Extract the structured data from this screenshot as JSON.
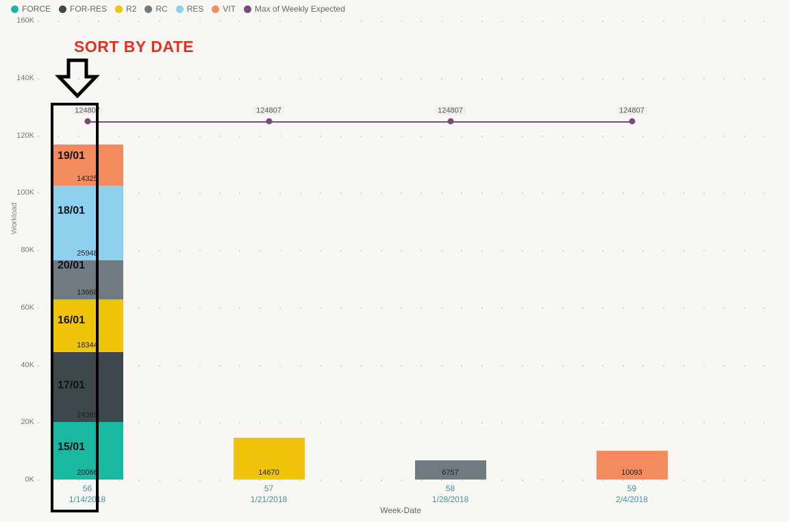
{
  "legend": [
    {
      "name": "FORCE",
      "color": "#19b8a1"
    },
    {
      "name": "FOR-RES",
      "color": "#3d474c"
    },
    {
      "name": "R2",
      "color": "#f0c40b"
    },
    {
      "name": "RC",
      "color": "#6f7b80"
    },
    {
      "name": "RES",
      "color": "#8ed1ef"
    },
    {
      "name": "VIT",
      "color": "#f48b5f"
    },
    {
      "name": "Max of Weekly Expected",
      "color": "#7a4b78"
    }
  ],
  "y_ticks": [
    "0K",
    "20K",
    "40K",
    "60K",
    "80K",
    "100K",
    "120K",
    "140K",
    "160K"
  ],
  "y_label": "Workload",
  "x_title": "Week-Date",
  "annotation_title": "SORT BY DATE",
  "dates_overlay": [
    "19/01",
    "18/01",
    "20/01",
    "16/01",
    "17/01",
    "15/01"
  ],
  "chart_data": {
    "type": "bar",
    "y_axis": {
      "label": "Workload",
      "min": 0,
      "max": 160000
    },
    "x_axis": {
      "label": "Week-Date"
    },
    "categories": [
      {
        "week": "56",
        "date": "1/14/2018"
      },
      {
        "week": "57",
        "date": "1/21/2018"
      },
      {
        "week": "58",
        "date": "1/28/2018"
      },
      {
        "week": "59",
        "date": "2/4/2018"
      }
    ],
    "stack_series": [
      "FORCE",
      "FOR-RES",
      "R2",
      "RC",
      "RES",
      "VIT"
    ],
    "stacked_bars": [
      {
        "FORCE": 20066,
        "FOR-RES": 24385,
        "R2": 18344,
        "RC": 13668,
        "RES": 25948,
        "VIT": 14325
      },
      {
        "R2": 14670
      },
      {
        "RC": 6757
      },
      {
        "VIT": 10093
      }
    ],
    "line": {
      "name": "Max of Weekly Expected",
      "values": [
        124807,
        124807,
        124807,
        124807
      ]
    }
  }
}
